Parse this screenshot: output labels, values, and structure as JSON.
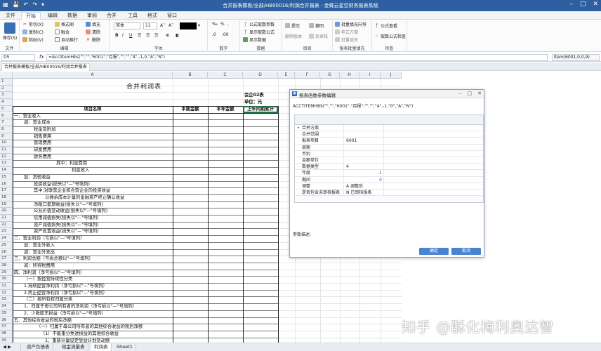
{
  "window": {
    "title": "合并报表模板/全部/HB00016/利润合并报表 - 金蝶云星空财务报表系统"
  },
  "menu": {
    "tabs": [
      "文件",
      "开始",
      "编辑",
      "数据",
      "审阅",
      "合并",
      "工具",
      "格式",
      "窗口"
    ],
    "active": "开始"
  },
  "ribbon": {
    "file": {
      "save": "保存(S)",
      "label": "文件"
    },
    "edit": {
      "cut": "剪切(X)",
      "copy": "复制(C)",
      "paste": "粘贴(V)",
      "format_painter": "格式刷",
      "merge": "融合",
      "autowrap": "自动换行",
      "fill": "填充",
      "clear": "清除",
      "delete": "删除",
      "label": "编辑"
    },
    "font": {
      "name": "宋体",
      "size": "11",
      "bold": "B",
      "italic": "I",
      "underline": "U",
      "label": "字体"
    },
    "number": {
      "label": "数字"
    },
    "data": {
      "formula_fetch": "公式取数参数",
      "show_fetch": "显示取数公式",
      "show_data": "显示数据",
      "label": "数据"
    },
    "review": {
      "submit": "提交",
      "revoke": "撤回",
      "delete_version": "删除版本",
      "reject": "反审核",
      "label": "审阅"
    },
    "batch": {
      "batch_fill": "批量填充向导",
      "style_plan": "样式方案",
      "batch_fill2": "批量填充",
      "label": "报表批量填充"
    },
    "check": {
      "formula_view": "公式查看",
      "fetch_check": "取数公式检查",
      "label": "检查"
    }
  },
  "formula_bar": {
    "cell": "D5",
    "fx": "fx",
    "formula": "=AcctItemHbs(\"\",\"\",\"6001\",\"月报\",\"\",\"\",\"4\",-1,0,\"A\",\"N\")",
    "item": "Item(6001,0,0,9)"
  },
  "doc_tab": "合并报表模板/全部/HB00016/利润合并报表",
  "sheet": {
    "columns": [
      "A",
      "B",
      "C",
      "D",
      "E",
      "F",
      "G",
      "H",
      "I",
      "J"
    ],
    "title": "合并利润表",
    "form_code": "会企02表",
    "unit": "单位：元",
    "headers": [
      "项目名称",
      "本期金额",
      "本年金额",
      "上年同期累计"
    ],
    "rows": [
      "一、营业收入",
      "减：营业成本",
      "税金及附加",
      "销售费用",
      "管理费用",
      "研发费用",
      "财务费用",
      "其中：利息费用",
      "利息收入",
      "加：其他收益",
      "投资收益(损失以\"—\"号填列)",
      "其中:对联营企业和合营企业的投资收益",
      "以摊余成本计量的金融资产终止确认收益",
      "净敞口套期收益(损失以\"—\"号填列)",
      "公允价值变动收益(损失以\"—\"号填列)",
      "信用减值损失(损失以\"—\"号填列)",
      "资产减值损失(损失以\"—\"号填列)",
      "资产处置收益(损失以\"—\"号填列)",
      "二、营业利润（亏损以\"—\"号填列）",
      "加：营业外收入",
      "减：营业外支出",
      "三、利润总额（亏损总额以\"—\"号填列）",
      "减：所得税费用",
      "四、净利润（净亏损以\"—\"号填列）",
      "（一）按经营持续性分类",
      "1.持续经营净利润（净亏损以\"—\"号填列）",
      "2.终止经营净利润（净亏损以\"—\"号填列）",
      "（二）按所有权归属分类",
      "1、归属于母公司所有者的净利润（净亏损以\"—\"号填列）",
      "2、少数股东损益（净亏损以\"—\"号填列）",
      "五、其他综合收益的税后净额",
      "（一）归属于母公司所有者的其他综合收益的税后净额",
      "（1）不能重分类进损益的其他综合收益",
      "1、重新计量设定受益计划变动额"
    ],
    "row_numbers": [
      "1",
      "2",
      "3",
      "4",
      "5",
      "6",
      "7",
      "8",
      "9",
      "10",
      "11",
      "12",
      "13",
      "14",
      "15",
      "16",
      "17",
      "18",
      "19",
      "20",
      "21",
      "22",
      "23",
      "24",
      "25",
      "26",
      "27",
      "28",
      "29",
      "30",
      "31",
      "32",
      "33",
      "34",
      "35",
      "36",
      "37",
      "38",
      "39"
    ]
  },
  "sheet_tabs": [
    "资产负债表",
    "现金流量表",
    "利润表",
    "Sheet1"
  ],
  "sheet_tab_active": "利润表",
  "dialog": {
    "title": "报表函数参数编辑",
    "formula": "ACCTITEMHBS(\"\",\"\",\"6001\",\"月报\",\"\",\"\",\"4\",-1,\"0\",\"A\",\"N\")",
    "params": [
      {
        "label": "合并方案",
        "value": ""
      },
      {
        "label": "合并范围",
        "value": ""
      },
      {
        "label": "报表项目",
        "value": "6001"
      },
      {
        "label": "周期",
        "value": ""
      },
      {
        "label": "币别",
        "value": ""
      },
      {
        "label": "金额单位",
        "value": ""
      },
      {
        "label": "数据类型",
        "value": "4"
      },
      {
        "label": "年度",
        "value": "-1"
      },
      {
        "label": "期间",
        "value": "0"
      },
      {
        "label": "调整",
        "value": "A  调整后"
      },
      {
        "label": "是否包含未审核报表",
        "value": "N  已审核报表"
      }
    ],
    "desc_label": "参数描述:",
    "ok": "确定",
    "cancel": "取消"
  },
  "watermark": "知乎 @酥化梅利奥达智"
}
